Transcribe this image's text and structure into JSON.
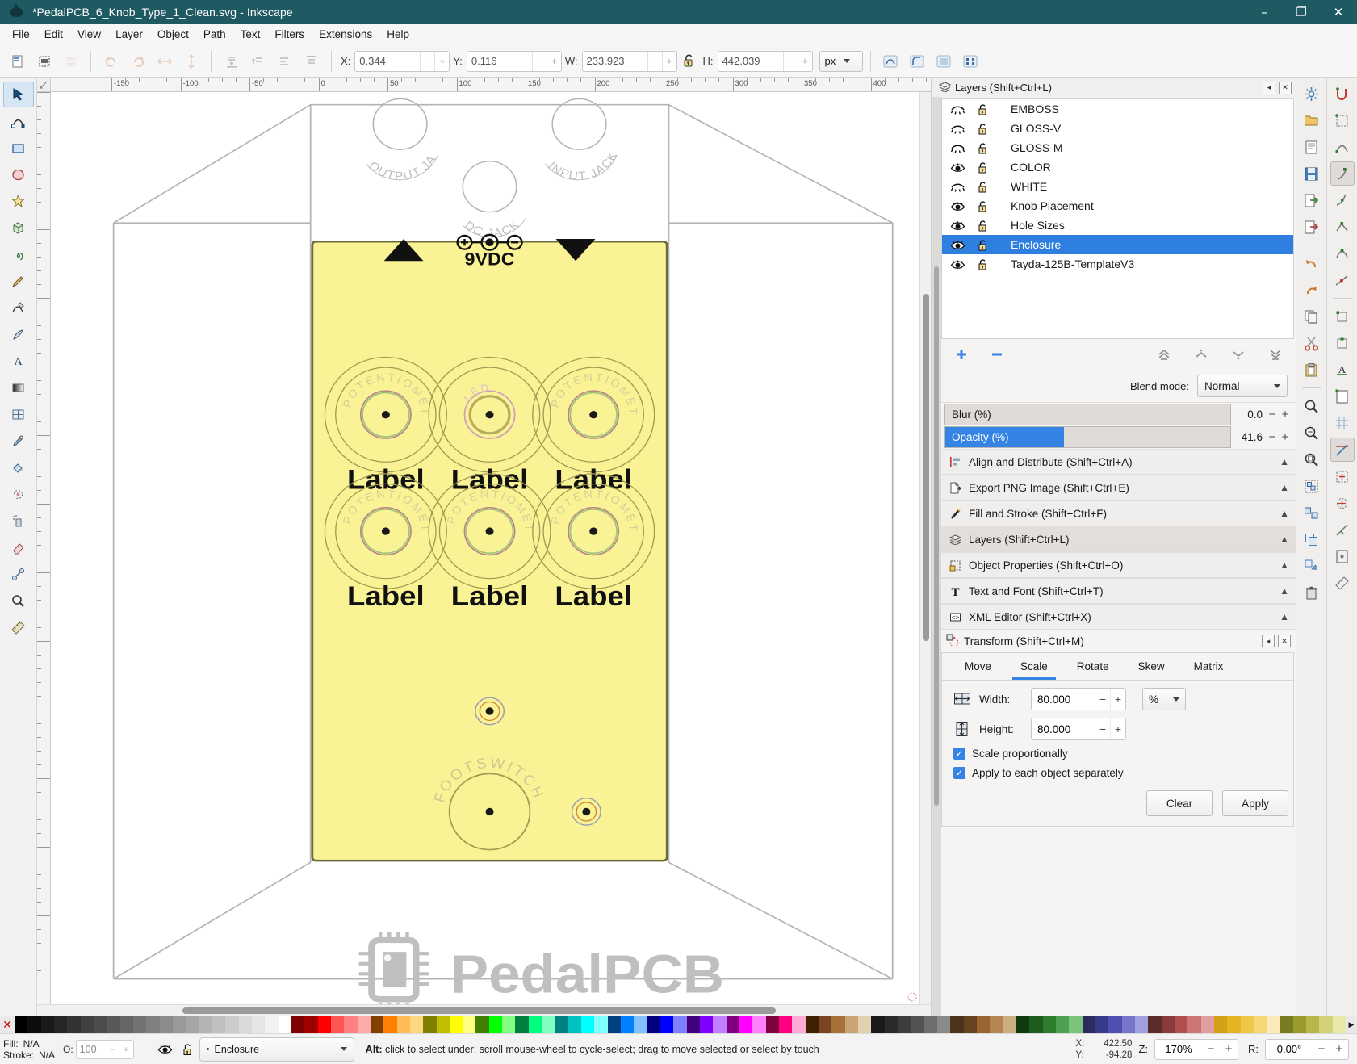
{
  "window": {
    "title": "*PedalPCB_6_Knob_Type_1_Clean.svg - Inkscape",
    "minimize": "–",
    "maximize": "❐",
    "close": "✕"
  },
  "menubar": {
    "items": [
      "File",
      "Edit",
      "View",
      "Layer",
      "Object",
      "Path",
      "Text",
      "Filters",
      "Extensions",
      "Help"
    ]
  },
  "toolbar": {
    "x_label": "X:",
    "x_value": "0.344",
    "y_label": "Y:",
    "y_value": "0.116",
    "w_label": "W:",
    "w_value": "233.923",
    "h_label": "H:",
    "h_value": "442.039",
    "unit": "px",
    "minus": "−",
    "plus": "+"
  },
  "rulers": {
    "h_labels": [
      "-150",
      "-100",
      "-50",
      "0",
      "50",
      "100",
      "150",
      "200",
      "250",
      "300",
      "350",
      "400"
    ]
  },
  "canvas": {
    "document_bg": "#ffffff",
    "enclosure_fill": "#faf396",
    "enclosure_stroke": "#6b6b3a",
    "template_stroke": "#b5b5b5",
    "top_markers": {
      "left": "▲",
      "right": "▽",
      "power": "9VDC"
    },
    "knob_ring_text": "POTENTIOMETER",
    "led_text": "LED",
    "footswitch_text": "FOOTSWITCH",
    "knob_labels": [
      "Label",
      "Label",
      "Label",
      "Label",
      "Label",
      "Label"
    ],
    "jack_labels": [
      "OUTPUT JACK",
      "INPUT JACK",
      "DC JACK"
    ],
    "logo_text": "PedalPCB"
  },
  "layers_panel": {
    "title": "Layers (Shift+Ctrl+L)",
    "items": [
      {
        "name": "EMBOSS",
        "visible": false,
        "locked": false
      },
      {
        "name": "GLOSS-V",
        "visible": false,
        "locked": false
      },
      {
        "name": "GLOSS-M",
        "visible": false,
        "locked": false
      },
      {
        "name": "COLOR",
        "visible": true,
        "locked": false
      },
      {
        "name": "WHITE",
        "visible": false,
        "locked": false
      },
      {
        "name": "Knob Placement",
        "visible": true,
        "locked": false
      },
      {
        "name": "Hole Sizes",
        "visible": true,
        "locked": false
      },
      {
        "name": "Enclosure",
        "visible": true,
        "locked": false,
        "selected": true
      },
      {
        "name": "Tayda-125B-TemplateV3",
        "visible": true,
        "locked": false
      }
    ],
    "add_label": "+",
    "remove_label": "−",
    "blend_mode_label": "Blend mode:",
    "blend_mode_value": "Normal",
    "blur_label": "Blur (%)",
    "blur_value": "0.0",
    "blur_percent": 0,
    "opacity_label": "Opacity (%)",
    "opacity_value": "41.6",
    "opacity_percent": 41.6,
    "selected_color": "#2f7fe0"
  },
  "panels": [
    {
      "label": "Align and Distribute (Shift+Ctrl+A)",
      "icon": "align-icon",
      "active": false
    },
    {
      "label": "Export PNG Image (Shift+Ctrl+E)",
      "icon": "export-icon",
      "active": false
    },
    {
      "label": "Fill and Stroke (Shift+Ctrl+F)",
      "icon": "fill-stroke-icon",
      "active": false
    },
    {
      "label": "Layers (Shift+Ctrl+L)",
      "icon": "layers-icon",
      "active": true
    },
    {
      "label": "Object Properties (Shift+Ctrl+O)",
      "icon": "object-properties-icon",
      "active": false
    },
    {
      "label": "Text and Font (Shift+Ctrl+T)",
      "icon": "text-font-icon",
      "active": false
    },
    {
      "label": "XML Editor (Shift+Ctrl+X)",
      "icon": "xml-editor-icon",
      "active": false
    }
  ],
  "transform_panel": {
    "title": "Transform (Shift+Ctrl+M)",
    "tabs": [
      "Move",
      "Scale",
      "Rotate",
      "Skew",
      "Matrix"
    ],
    "active_tab": "Scale",
    "width_label": "Width:",
    "width_value": "80.000",
    "height_label": "Height:",
    "height_value": "80.000",
    "unit": "%",
    "scale_proportionally_label": "Scale proportionally",
    "scale_proportionally_checked": true,
    "apply_each_label": "Apply to each object separately",
    "apply_each_checked": true,
    "clear_label": "Clear",
    "apply_label": "Apply",
    "minus": "−",
    "plus": "+"
  },
  "statusbar": {
    "fill_label": "Fill:",
    "fill_value": "N/A",
    "stroke_label": "Stroke:",
    "stroke_value": "N/A",
    "opacity_label": "O:",
    "opacity_value": "100",
    "current_layer": "Enclosure",
    "message_prefix": "Alt:",
    "message": "click to select under; scroll mouse-wheel to cycle-select; drag to move selected or select by touch",
    "x_label": "X:",
    "x_value": "422.50",
    "y_label": "Y:",
    "y_value": "-94.28",
    "zoom_label": "Z:",
    "zoom_value": "170%",
    "rotate_label": "R:",
    "rotate_value": "0.00°",
    "minus": "−",
    "plus": "+"
  },
  "palette": {
    "colors": [
      "#000000",
      "#0d0d0d",
      "#1a1a1a",
      "#262626",
      "#333333",
      "#404040",
      "#4d4d4d",
      "#595959",
      "#666666",
      "#737373",
      "#808080",
      "#8c8c8c",
      "#999999",
      "#a6a6a6",
      "#b3b3b3",
      "#bfbfbf",
      "#cccccc",
      "#d9d9d9",
      "#e6e6e6",
      "#f2f2f2",
      "#ffffff",
      "#800000",
      "#a00000",
      "#ff0000",
      "#ff5555",
      "#ff8080",
      "#ffaaaa",
      "#804000",
      "#ff8000",
      "#ffbb55",
      "#ffd580",
      "#808000",
      "#bfbf00",
      "#ffff00",
      "#ffff80",
      "#408000",
      "#00ff00",
      "#80ff80",
      "#008040",
      "#00ff80",
      "#80ffc0",
      "#008080",
      "#00c0c0",
      "#00ffff",
      "#80ffff",
      "#004080",
      "#0080ff",
      "#80c0ff",
      "#000080",
      "#0000ff",
      "#8080ff",
      "#400080",
      "#8000ff",
      "#c080ff",
      "#800080",
      "#ff00ff",
      "#ff80ff",
      "#800040",
      "#ff0080",
      "#ffaad4",
      "#402000",
      "#7a4520",
      "#a8713a",
      "#caa472",
      "#e3d0b0",
      "#1a1a1a",
      "#2b2b2b",
      "#3d3d3d",
      "#525252",
      "#6e6e6e",
      "#8a8a8a",
      "#4d3319",
      "#66441f",
      "#996633",
      "#b38653",
      "#ccae7f",
      "#103a10",
      "#1f5c1f",
      "#2e7d2e",
      "#4fa14f",
      "#7cc47c",
      "#2b2b5e",
      "#3a3a8a",
      "#4f4fb0",
      "#7575cc",
      "#a0a0e0",
      "#5e2b2b",
      "#8a3a3a",
      "#b04f4f",
      "#cc7575",
      "#e0a0a0",
      "#d4a017",
      "#e6b422",
      "#f0c849",
      "#f5d87a",
      "#faebb8",
      "#7a7a1f",
      "#9a9a2e",
      "#b8b84a",
      "#d2d278",
      "#eaeaa8"
    ]
  },
  "tools": {
    "items": [
      {
        "name": "selector-tool",
        "glyph": "➤",
        "active": true
      },
      {
        "name": "node-tool",
        "glyph": "✐",
        "active": false
      },
      {
        "name": "rectangle-tool",
        "glyph": "▭",
        "active": false
      },
      {
        "name": "ellipse-tool",
        "glyph": "◯",
        "active": false
      },
      {
        "name": "star-tool",
        "glyph": "★",
        "active": false
      },
      {
        "name": "box-3d-tool",
        "glyph": "⬡",
        "active": false
      },
      {
        "name": "spiral-tool",
        "glyph": "◔",
        "active": false
      },
      {
        "name": "pencil-tool",
        "glyph": "✎",
        "active": false
      },
      {
        "name": "pen-tool",
        "glyph": "✒",
        "active": false
      },
      {
        "name": "text-tool",
        "glyph": "A",
        "active": false
      },
      {
        "name": "gradient-tool",
        "glyph": "◧",
        "active": false
      },
      {
        "name": "mesh-tool",
        "glyph": "⊞",
        "active": false
      },
      {
        "name": "dropper-tool",
        "glyph": "☂",
        "active": false
      },
      {
        "name": "paint-bucket-tool",
        "glyph": "◕",
        "active": false
      },
      {
        "name": "tweak-tool",
        "glyph": "✿",
        "active": false
      },
      {
        "name": "spray-tool",
        "glyph": "❈",
        "active": false
      },
      {
        "name": "eraser-tool",
        "glyph": "◰",
        "active": false
      },
      {
        "name": "connector-tool",
        "glyph": "⑂",
        "active": false
      },
      {
        "name": "zoom-tool",
        "glyph": "⌕",
        "active": false
      },
      {
        "name": "measure-tool",
        "glyph": "✀",
        "active": false
      }
    ]
  }
}
